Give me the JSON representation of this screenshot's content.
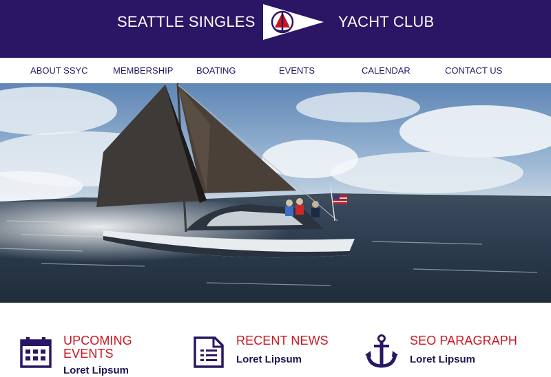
{
  "header": {
    "title_left": "SEATTLE SINGLES",
    "title_right": "YACHT CLUB",
    "bg_color": "#2a1664"
  },
  "nav": {
    "items": [
      {
        "label": "ABOUT SSYC"
      },
      {
        "label": "MEMBERSHIP"
      },
      {
        "label": "BOATING"
      },
      {
        "label": "EVENTS"
      },
      {
        "label": "CALENDAR"
      },
      {
        "label": "CONTACT US"
      }
    ]
  },
  "features": [
    {
      "heading_line1": "UPCOMING",
      "heading_line2": "EVENTS",
      "subtext": "Loret Lipsum",
      "icon": "calendar-icon"
    },
    {
      "heading_line1": "RECENT NEWS",
      "subtext": "Loret Lipsum",
      "icon": "document-icon"
    },
    {
      "heading_line1": "SEO PARAGRAPH",
      "subtext": "Loret Lipsum",
      "icon": "anchor-icon"
    }
  ],
  "colors": {
    "primary": "#2a1664",
    "accent": "#cc1420",
    "text_dark": "#1e1450"
  }
}
